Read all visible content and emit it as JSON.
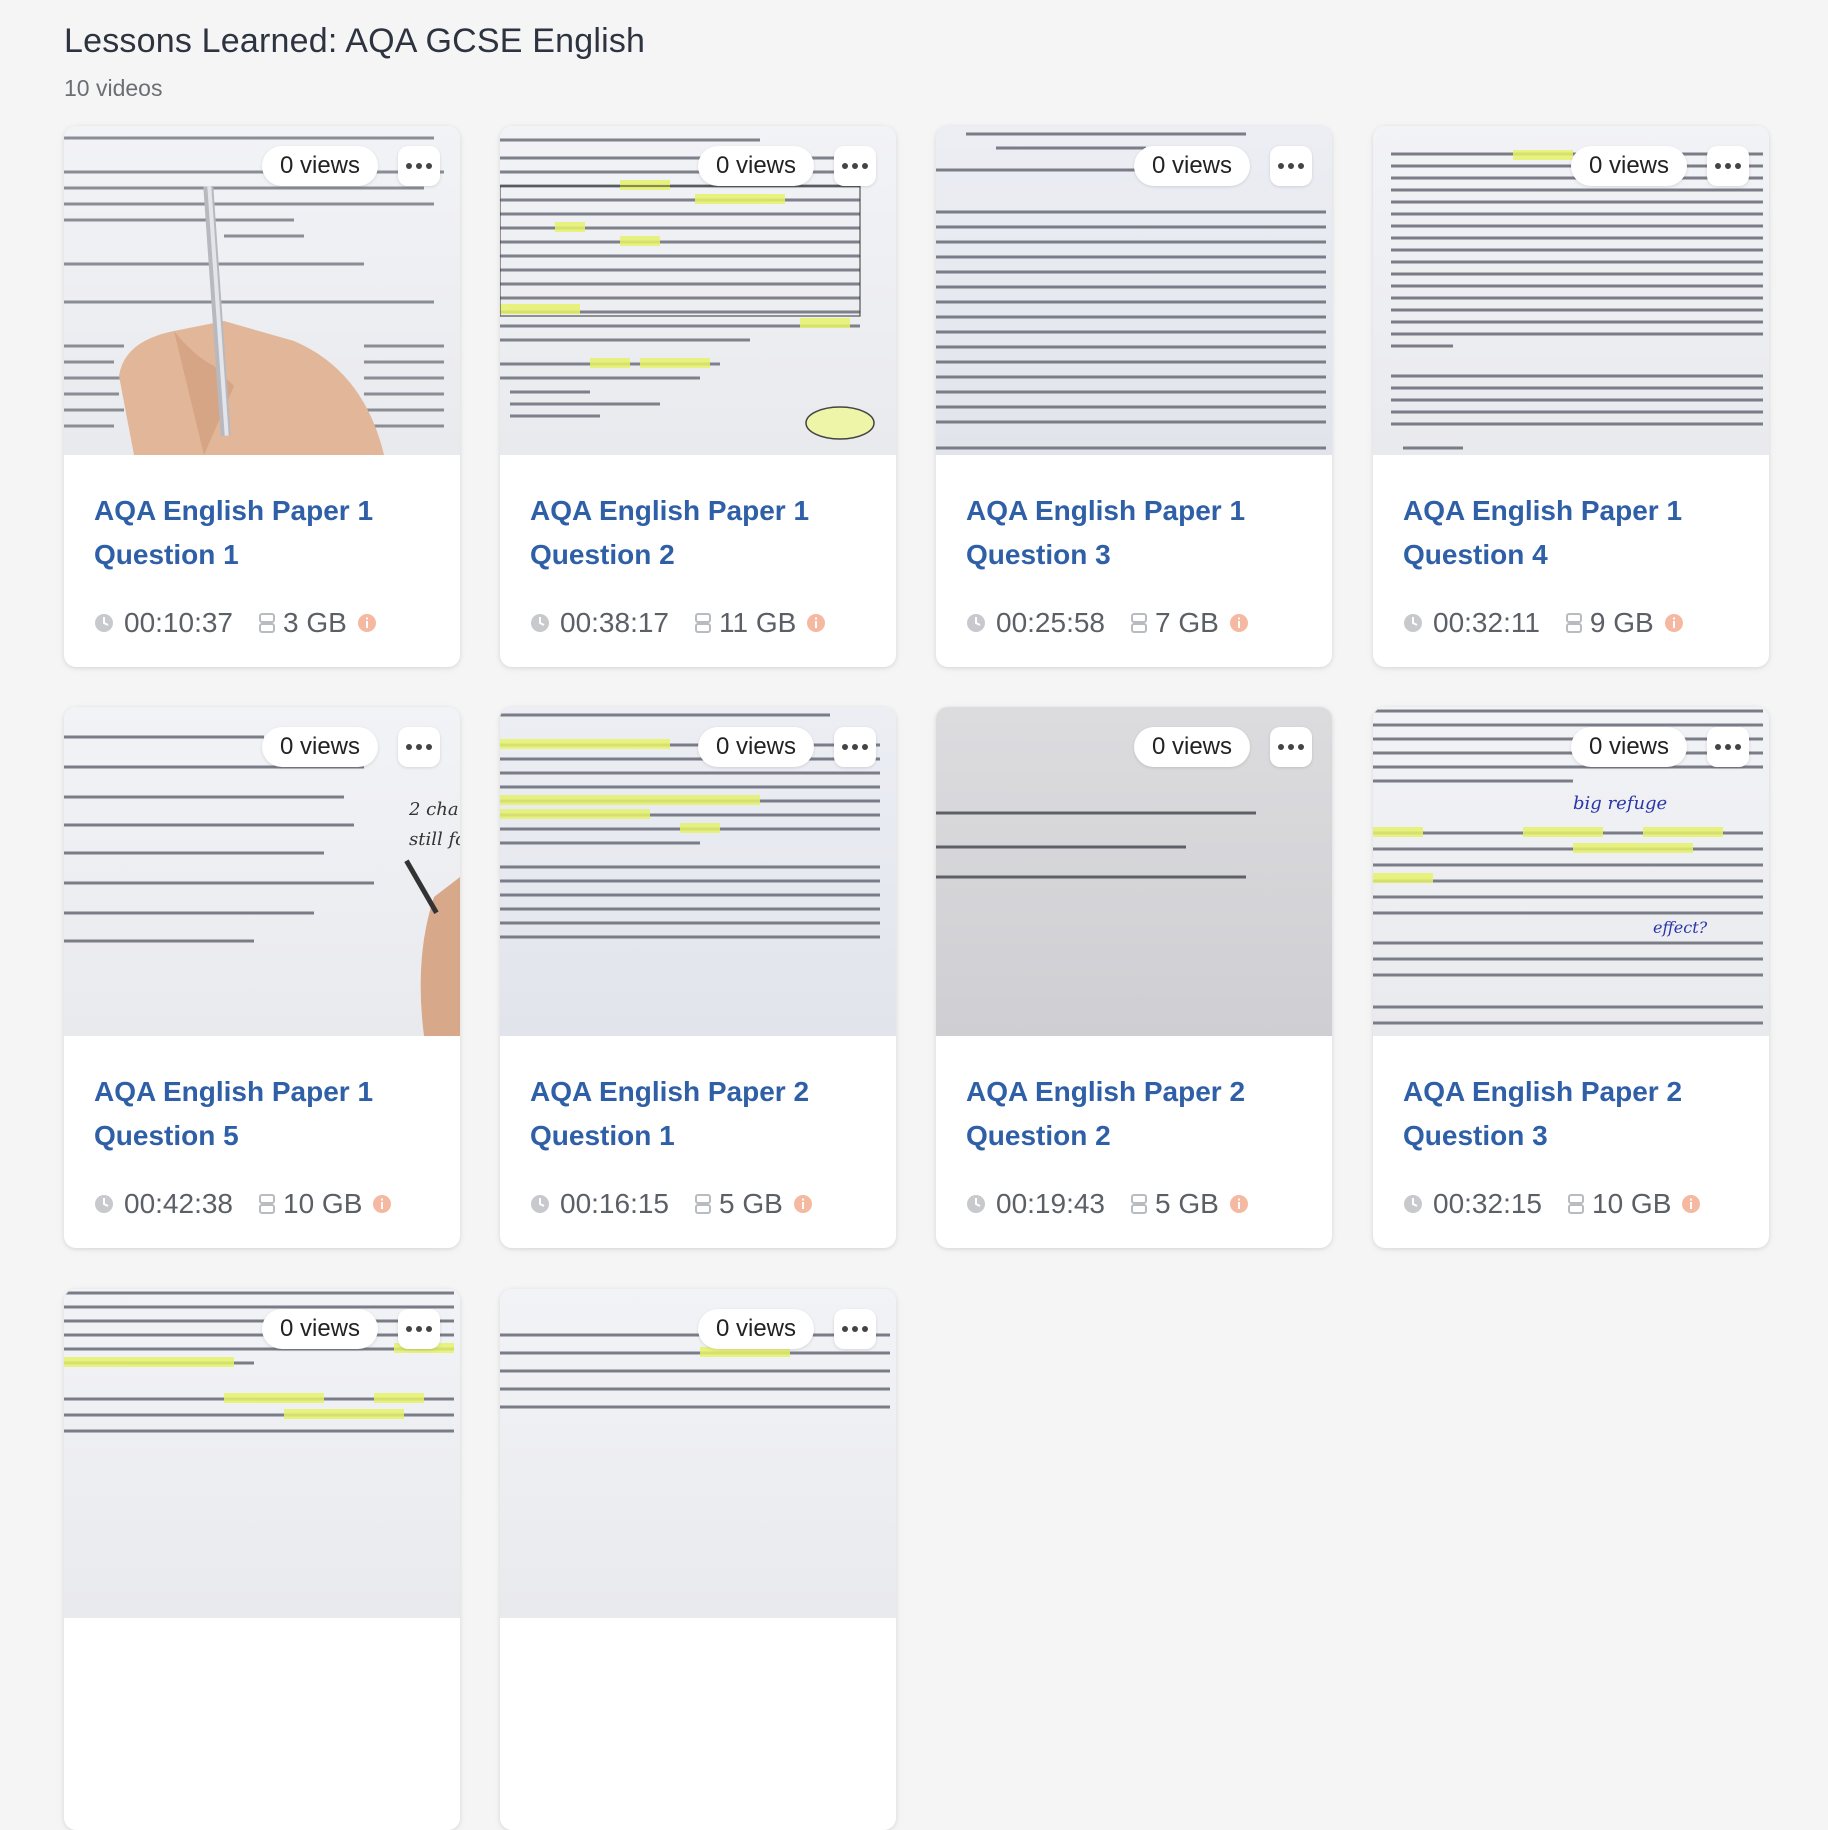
{
  "page": {
    "title": "Lessons Learned: AQA GCSE English",
    "video_count": "10 videos"
  },
  "colors": {
    "title": "#2f5fa7",
    "info": "#f2a58a",
    "meta": "#5b5f66"
  },
  "videos": [
    {
      "title": "AQA English Paper 1 Question 1",
      "views": "0 views",
      "duration": "00:10:37",
      "size": "3 GB"
    },
    {
      "title": "AQA English Paper 1 Question 2",
      "views": "0 views",
      "duration": "00:38:17",
      "size": "11 GB"
    },
    {
      "title": "AQA English Paper 1 Question 3",
      "views": "0 views",
      "duration": "00:25:58",
      "size": "7 GB"
    },
    {
      "title": "AQA English Paper 1 Question 4",
      "views": "0 views",
      "duration": "00:32:11",
      "size": "9 GB"
    },
    {
      "title": "AQA English Paper 1 Question 5",
      "views": "0 views",
      "duration": "00:42:38",
      "size": "10 GB"
    },
    {
      "title": "AQA English Paper 2 Question 1",
      "views": "0 views",
      "duration": "00:16:15",
      "size": "5 GB"
    },
    {
      "title": "AQA English Paper 2 Question 2",
      "views": "0 views",
      "duration": "00:19:43",
      "size": "5 GB"
    },
    {
      "title": "AQA English Paper 2 Question 3",
      "views": "0 views",
      "duration": "00:32:15",
      "size": "10 GB"
    },
    {
      "title": "",
      "views": "0 views",
      "duration": "",
      "size": ""
    },
    {
      "title": "",
      "views": "0 views",
      "duration": "",
      "size": ""
    }
  ],
  "icons": {
    "menu": "more-horizontal-icon",
    "duration": "clock-icon",
    "size": "drive-icon",
    "info": "info-icon"
  }
}
